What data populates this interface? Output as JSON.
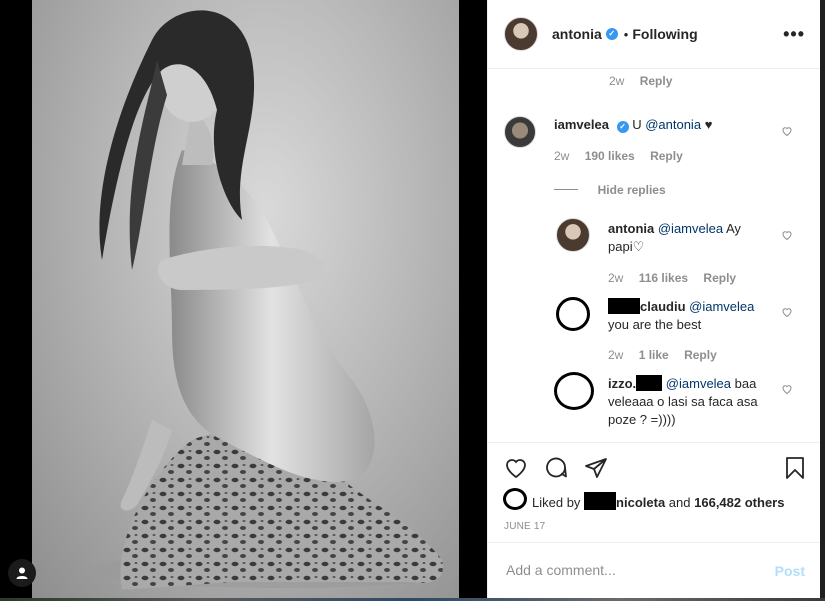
{
  "header": {
    "username": "antonia",
    "separator": "•",
    "follow_status": "Following",
    "more_glyph": "•••"
  },
  "comments": [
    {
      "meta": {
        "time": "2w",
        "reply": "Reply"
      }
    },
    {
      "username": "iamvelea",
      "text": "U",
      "mention": "@antonia",
      "emoji": "♥",
      "meta": {
        "time": "2w",
        "likes": "190 likes",
        "reply": "Reply"
      },
      "hide_replies": "Hide replies"
    }
  ],
  "replies": [
    {
      "username": "antonia",
      "mention": "@iamvelea",
      "text_line1": "Ay",
      "text_line2": "papi♡",
      "meta": {
        "time": "2w",
        "likes": "116 likes",
        "reply": "Reply"
      }
    },
    {
      "username": "claudiu",
      "mention": "@iamvelea",
      "text_line2": "you are the best",
      "meta": {
        "time": "2w",
        "likes": "1 like",
        "reply": "Reply"
      }
    },
    {
      "username_prefix": "izzo.",
      "mention": "@iamvelea",
      "text_line1": "baa",
      "text_line2": "veleaaa o lasi sa faca asa",
      "text_line3": "poze ? =))))"
    }
  ],
  "likes": {
    "liked_by_label": "Liked by",
    "name": "nicoleta",
    "and_label": "and",
    "others": "166,482 others"
  },
  "date": "JUNE 17",
  "composer": {
    "placeholder": "Add a comment...",
    "post_label": "Post"
  },
  "icons": [
    "heart-icon",
    "comment-icon",
    "share-icon",
    "bookmark-icon",
    "user-tag-icon",
    "verified-badge-icon",
    "more-options-icon"
  ],
  "colors": {
    "link": "#003569",
    "verified": "#3897f0",
    "post_disabled": "#b2dffc",
    "meta": "#8e8e8e"
  }
}
